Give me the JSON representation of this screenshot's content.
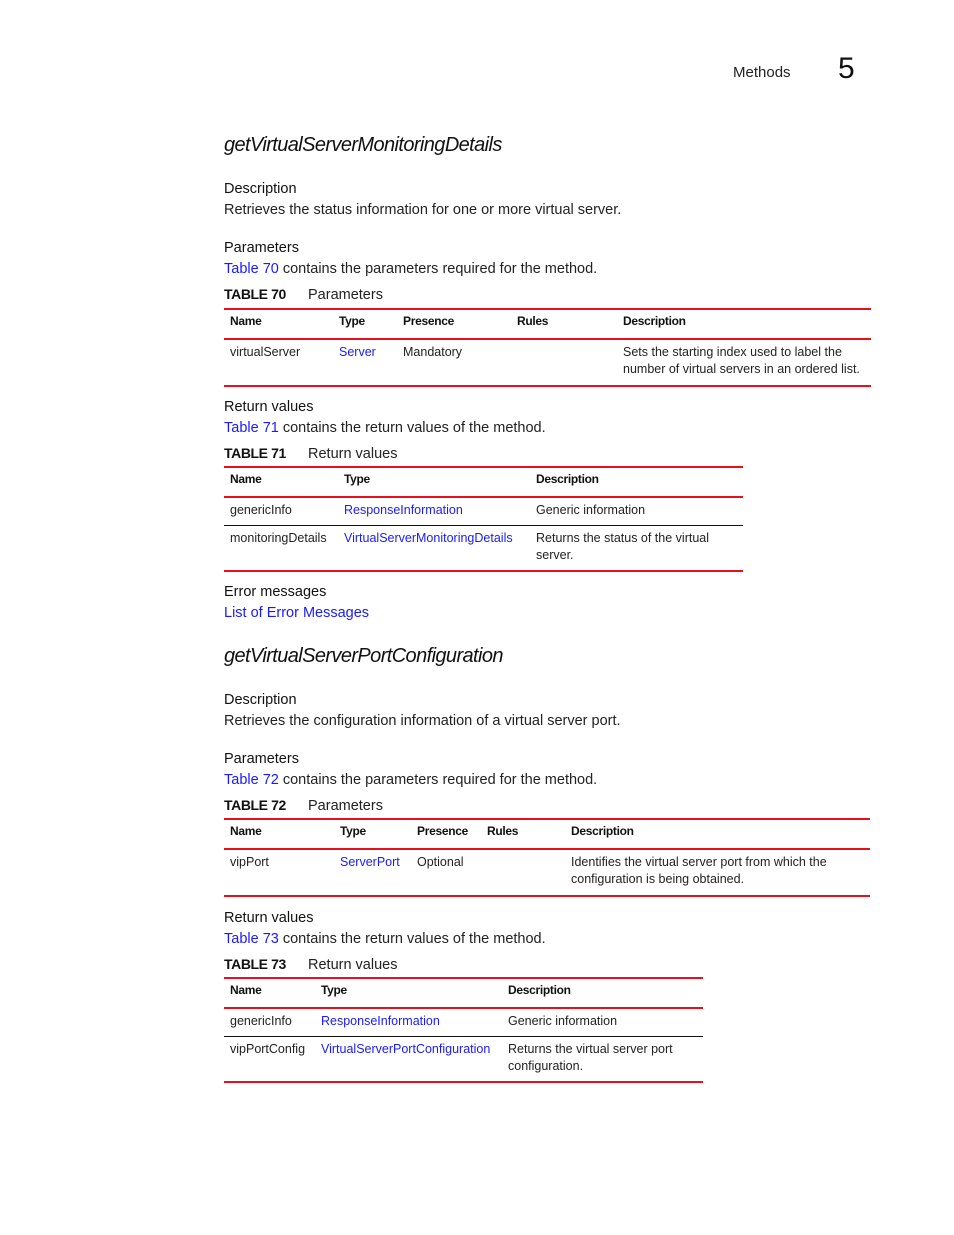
{
  "header": {
    "running_head": "Methods",
    "chapter_number": "5"
  },
  "sections": [
    {
      "title": "getVirtualServerMonitoringDetails",
      "description_heading": "Description",
      "description": "Retrieves the status information for one or more virtual server.",
      "parameters_heading": "Parameters",
      "parameters_ref_link": "Table 70",
      "parameters_ref_text": " contains the parameters required for the method.",
      "parameters_table": {
        "number": "TABLE 70",
        "caption": "Parameters",
        "headers": [
          "Name",
          "Type",
          "Presence",
          "Rules",
          "Description"
        ],
        "rows": [
          {
            "name": "virtualServer",
            "type": "Server",
            "presence": "Mandatory",
            "rules": "",
            "description": "Sets the starting index used to label the number of virtual servers in an ordered list."
          }
        ]
      },
      "return_heading": "Return values",
      "return_ref_link": "Table 71",
      "return_ref_text": " contains the return values of the method.",
      "return_table": {
        "number": "TABLE 71",
        "caption": "Return values",
        "headers": [
          "Name",
          "Type",
          "Description"
        ],
        "rows": [
          {
            "name": "genericInfo",
            "type": "ResponseInformation",
            "description": "Generic information"
          },
          {
            "name": "monitoringDetails",
            "type": "VirtualServerMonitoringDetails",
            "description": "Returns the status of the virtual server."
          }
        ]
      },
      "errors_heading": "Error messages",
      "errors_link": "List of Error Messages"
    },
    {
      "title": "getVirtualServerPortConfiguration",
      "description_heading": "Description",
      "description": "Retrieves the configuration information of a virtual server port.",
      "parameters_heading": "Parameters",
      "parameters_ref_link": "Table 72",
      "parameters_ref_text": " contains the parameters required for the method.",
      "parameters_table": {
        "number": "TABLE 72",
        "caption": "Parameters",
        "headers": [
          "Name",
          "Type",
          "Presence",
          "Rules",
          "Description"
        ],
        "rows": [
          {
            "name": "vipPort",
            "type": "ServerPort",
            "presence": "Optional",
            "rules": "",
            "description": "Identifies the virtual server port from which the configuration is being obtained."
          }
        ]
      },
      "return_heading": "Return values",
      "return_ref_link": "Table 73",
      "return_ref_text": " contains the return values of the method.",
      "return_table": {
        "number": "TABLE 73",
        "caption": "Return values",
        "headers": [
          "Name",
          "Type",
          "Description"
        ],
        "rows": [
          {
            "name": "genericInfo",
            "type": "ResponseInformation",
            "description": "Generic information"
          },
          {
            "name": "vipPortConfig",
            "type": "VirtualServerPortConfiguration",
            "description": "Returns the virtual server port configuration."
          }
        ]
      }
    }
  ],
  "colors": {
    "rule_red": "#e8101c",
    "link_blue": "#1a1aff"
  }
}
